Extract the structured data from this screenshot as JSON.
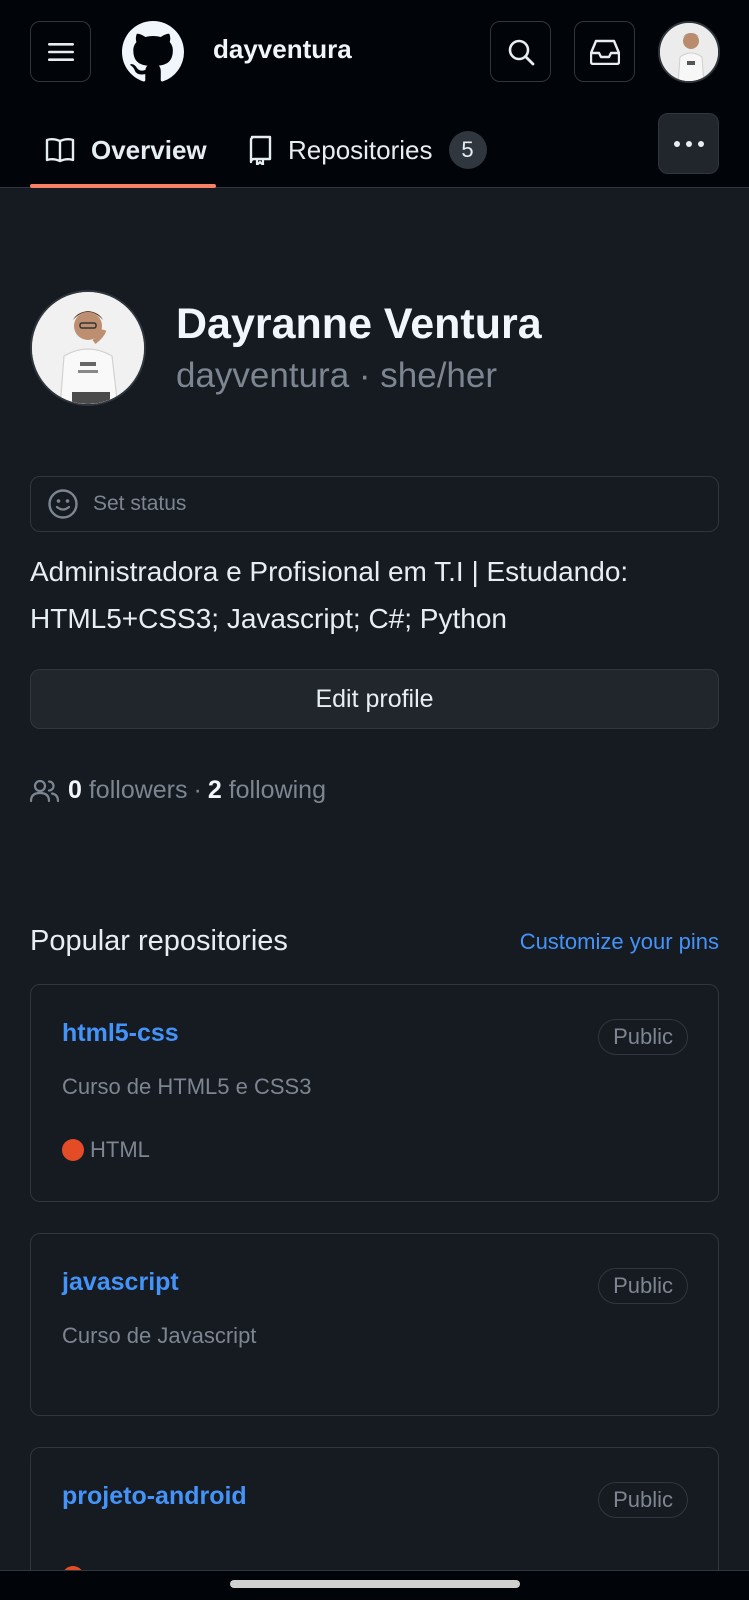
{
  "header": {
    "username": "dayventura",
    "tabs": [
      {
        "label": "Overview"
      },
      {
        "label": "Repositories",
        "count": "5"
      }
    ]
  },
  "profile": {
    "name": "Dayranne Ventura",
    "handle": "dayventura · she/her",
    "status_placeholder": "Set status",
    "bio_line1": "Administradora e Profisional em T.I | Estudando:",
    "bio_line2": "HTML5+CSS3; Javascript; C#; Python",
    "edit_label": "Edit profile",
    "followers_count": "0",
    "followers_label": "followers",
    "following_count": "2",
    "following_label": "following"
  },
  "popular": {
    "title": "Popular repositories",
    "customize_label": "Customize your pins",
    "repos": [
      {
        "name": "html5-css",
        "visibility": "Public",
        "description": "Curso de HTML5 e CSS3",
        "language": "HTML",
        "language_color": "#e34c26"
      },
      {
        "name": "javascript",
        "visibility": "Public",
        "description": "Curso de Javascript"
      },
      {
        "name": "projeto-android",
        "visibility": "Public"
      }
    ]
  },
  "colors": {
    "accent_link": "#4493f8",
    "tab_underline": "#f78166",
    "background": "#161b22",
    "header_background": "#010409"
  }
}
